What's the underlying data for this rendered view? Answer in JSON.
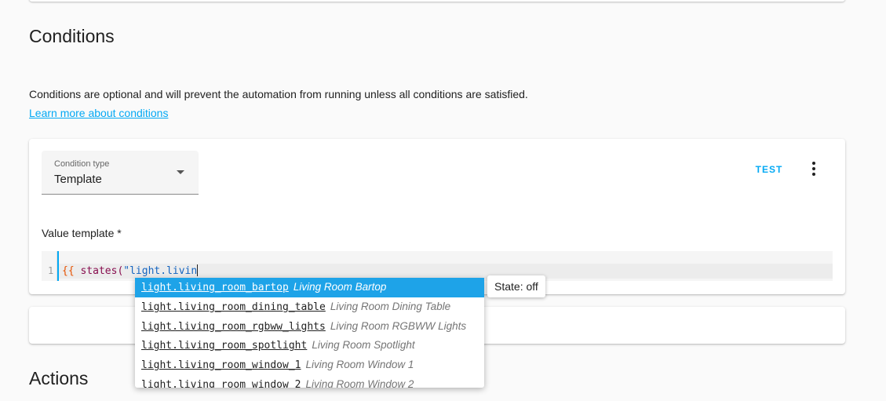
{
  "conditions": {
    "heading": "Conditions",
    "description": "Conditions are optional and will prevent the automation from running unless all conditions are satisfied.",
    "learn_more": "Learn more about conditions"
  },
  "condition_card": {
    "select_label": "Condition type",
    "select_value": "Template",
    "test_label": "TEST",
    "value_label": "Value template *",
    "editor": {
      "line_number": "1",
      "code_brace": "{{ ",
      "code_fn": "states",
      "code_paren": "(",
      "code_str": "\"light.livin"
    }
  },
  "autocomplete": {
    "items": [
      {
        "id": "light.living_room_bartop",
        "name": "Living Room Bartop"
      },
      {
        "id": "light.living_room_dining_table",
        "name": "Living Room Dining Table"
      },
      {
        "id": "light.living_room_rgbww_lights",
        "name": "Living Room RGBWW Lights"
      },
      {
        "id": "light.living_room_spotlight",
        "name": "Living Room Spotlight"
      },
      {
        "id": "light.living_room_window_1",
        "name": "Living Room Window 1"
      },
      {
        "id": "light.living_room_window_2",
        "name": "Living Room Window 2"
      }
    ],
    "tooltip": "State: off"
  },
  "actions": {
    "heading": "Actions"
  },
  "colors": {
    "accent": "#03a9f4",
    "selection": "#1ea3e8"
  }
}
